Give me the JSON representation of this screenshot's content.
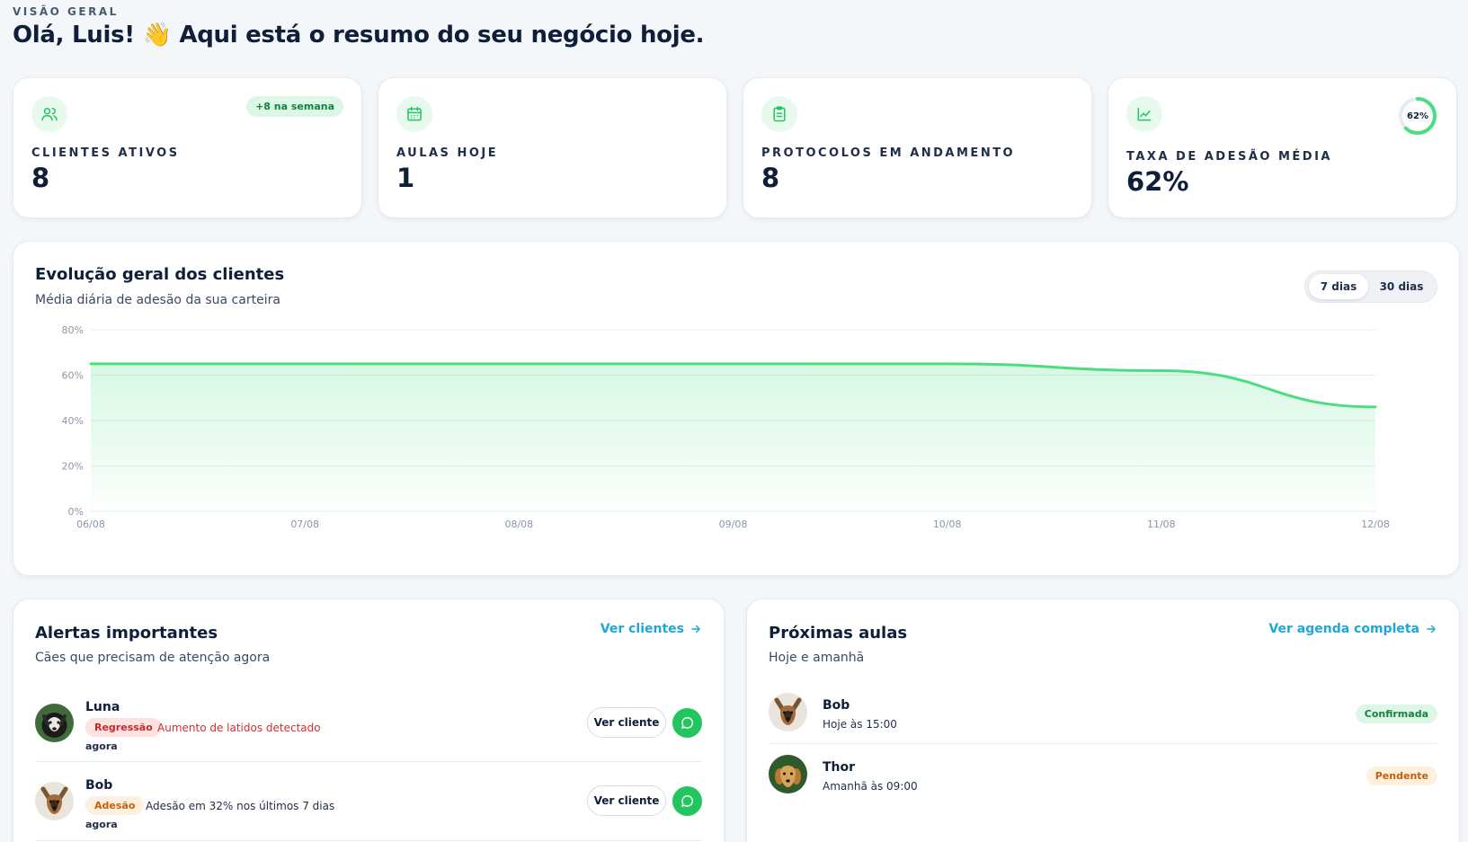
{
  "header": {
    "eyebrow": "VISÃO GERAL",
    "title": "Olá, Luis! 👋 Aqui está o resumo do seu negócio hoje."
  },
  "stats": [
    {
      "icon": "users-icon",
      "label": "CLIENTES ATIVOS",
      "value": "8",
      "badge": "+8 na semana"
    },
    {
      "icon": "calendar-icon",
      "label": "AULAS HOJE",
      "value": "1"
    },
    {
      "icon": "clipboard-icon",
      "label": "PROTOCOLOS EM ANDAMENTO",
      "value": "8"
    },
    {
      "icon": "line-chart-icon",
      "label": "TAXA DE ADESÃO MÉDIA",
      "value": "62%",
      "ring_label": "62%",
      "ring_fraction": 0.62
    }
  ],
  "chart": {
    "title": "Evolução geral dos clientes",
    "subtitle": "Média diária de adesão da sua carteira",
    "toggle": {
      "active": "7 dias",
      "other": "30 dias"
    }
  },
  "chart_data": {
    "type": "area",
    "x": [
      "06/08",
      "07/08",
      "08/08",
      "09/08",
      "10/08",
      "11/08",
      "12/08"
    ],
    "series": [
      {
        "values": [
          65,
          65,
          65,
          65,
          65,
          62,
          46
        ]
      }
    ],
    "yticks": [
      "0%",
      "20%",
      "40%",
      "60%",
      "80%"
    ],
    "ylim": [
      0,
      80
    ],
    "grid": true,
    "color": "#4ade80"
  },
  "alerts": {
    "title": "Alertas importantes",
    "subtitle": "Cães que precisam de atenção agora",
    "link": "Ver clientes",
    "items": [
      {
        "name": "Luna",
        "tag": "Regressão",
        "tag_color": "red",
        "desc": "Aumento de latidos detectado",
        "time": "agora",
        "button": "Ver cliente"
      },
      {
        "name": "Bob",
        "tag": "Adesão",
        "tag_color": "orange",
        "desc": "Adesão em 32% nos últimos 7 dias",
        "time": "agora",
        "button": "Ver cliente"
      }
    ]
  },
  "classes": {
    "title": "Próximas aulas",
    "subtitle": "Hoje e amanhã",
    "link": "Ver agenda completa",
    "items": [
      {
        "name": "Bob",
        "when": "Hoje às 15:00",
        "status": "Confirmada",
        "status_color": "green"
      },
      {
        "name": "Thor",
        "when": "Amanhã às 09:00",
        "status": "Pendente",
        "status_color": "orange"
      }
    ]
  },
  "colors": {
    "accent": "#22c55e",
    "link": "#1fa7d8",
    "text": "#0f1f3a"
  }
}
